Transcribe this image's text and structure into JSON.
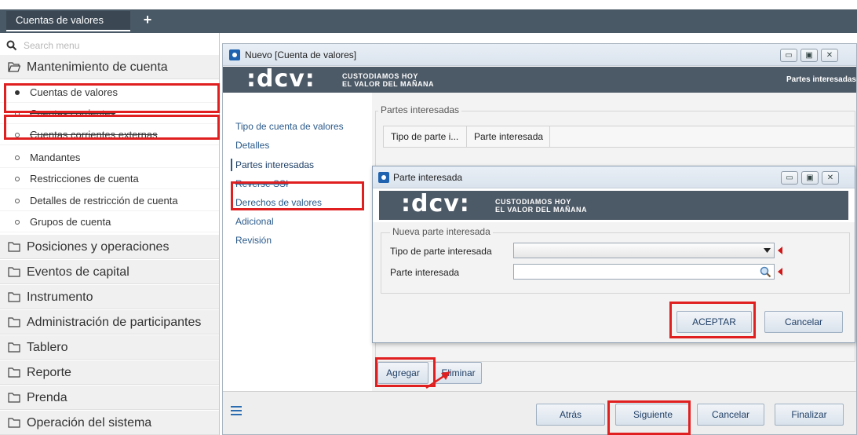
{
  "topbar": {
    "tab_label": "Cuentas de valores",
    "add_tab": "+"
  },
  "sidebar": {
    "search_placeholder": "Search menu",
    "sections": [
      {
        "label": "Mantenimiento de cuenta"
      },
      {
        "label": "Posiciones y operaciones"
      },
      {
        "label": "Eventos de capital"
      },
      {
        "label": "Instrumento"
      },
      {
        "label": "Administración de participantes"
      },
      {
        "label": "Tablero"
      },
      {
        "label": "Reporte"
      },
      {
        "label": "Prenda"
      },
      {
        "label": "Operación del sistema"
      }
    ],
    "items": [
      {
        "label": "Cuentas de valores"
      },
      {
        "label": "Cuentas corrientes"
      },
      {
        "label": "Cuentas corrientes externas"
      },
      {
        "label": "Mandantes"
      },
      {
        "label": "Restricciones de cuenta"
      },
      {
        "label": "Detalles de restricción de cuenta"
      },
      {
        "label": "Grupos de cuenta"
      }
    ]
  },
  "window": {
    "title": "Nuevo [Cuenta de valores]",
    "banner_logo": ":dcv:",
    "banner_tag_1": "CUSTODIAMOS HOY",
    "banner_tag_2": "EL VALOR DEL MAÑANA",
    "banner_right": "Partes interesadas",
    "nav": [
      {
        "label": "Tipo de cuenta de valores"
      },
      {
        "label": "Detalles"
      },
      {
        "label": "Partes interesadas"
      },
      {
        "label": "Reverse SSI"
      },
      {
        "label": "Derechos de valores"
      },
      {
        "label": "Adicional"
      },
      {
        "label": "Revisión"
      }
    ],
    "group_title": "Partes interesadas",
    "columns": [
      "Tipo de parte i...",
      "Parte interesada"
    ],
    "add_label": "Agregar",
    "delete_label": "Eliminar",
    "back_label": "Atrás",
    "next_label": "Siguiente",
    "cancel_label": "Cancelar",
    "finish_label": "Finalizar"
  },
  "dialog": {
    "title": "Parte interesada",
    "banner_tag_1": "CUSTODIAMOS HOY",
    "banner_tag_2": "EL VALOR DEL MAÑANA",
    "group_title": "Nueva parte interesada",
    "type_label": "Tipo de parte interesada",
    "type_value": "",
    "party_label": "Parte interesada",
    "party_value": "",
    "accept_label": "ACEPTAR",
    "cancel_label": "Cancelar"
  },
  "colors": {
    "header": "#4a5966",
    "banner": "#4c5966",
    "highlight": "#e02020",
    "link": "#2b5a8a"
  }
}
